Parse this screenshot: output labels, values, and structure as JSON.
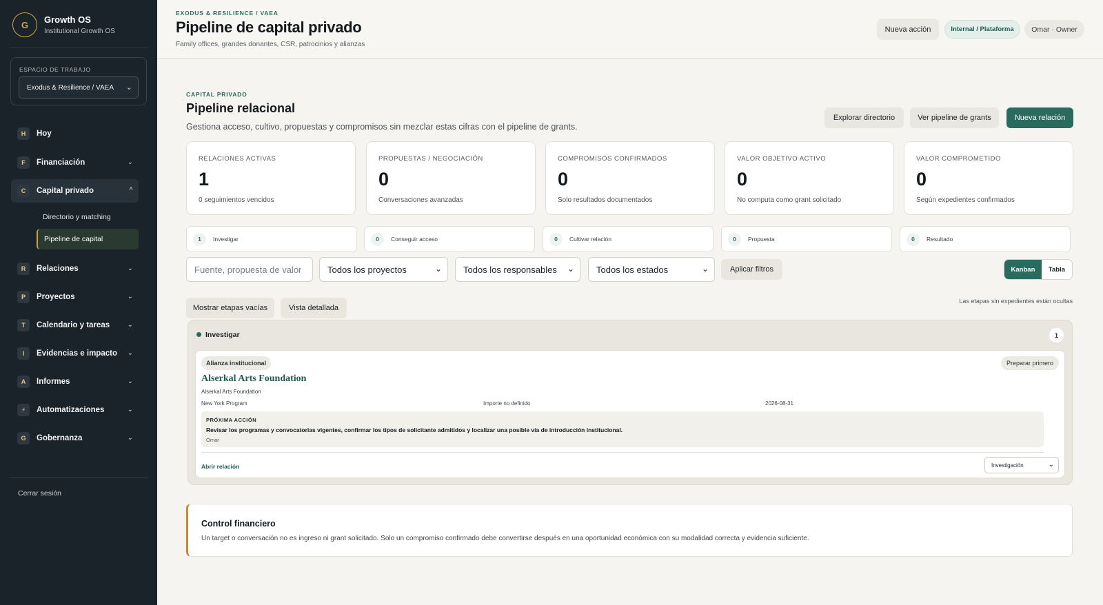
{
  "brand": {
    "logo_letter": "G",
    "name": "Growth OS",
    "subtitle": "Institutional Growth OS"
  },
  "workspace": {
    "label": "ESPACIO DE TRABAJO",
    "value": "Exodus & Resilience / VAEA"
  },
  "nav": {
    "hoy": {
      "badge": "H",
      "label": "Hoy"
    },
    "financiacion": {
      "badge": "F",
      "label": "Financiación"
    },
    "capital": {
      "badge": "C",
      "label": "Capital privado"
    },
    "capital_sub": [
      "Directorio y matching",
      "Pipeline de capital"
    ],
    "relaciones": {
      "badge": "R",
      "label": "Relaciones"
    },
    "proyectos": {
      "badge": "P",
      "label": "Proyectos"
    },
    "calendario": {
      "badge": "T",
      "label": "Calendario y tareas"
    },
    "evidencias": {
      "badge": "I",
      "label": "Evidencias e impacto"
    },
    "informes": {
      "badge": "A",
      "label": "Informes"
    },
    "automatizaciones": {
      "badge": "⚡",
      "label": "Automatizaciones"
    },
    "gobernanza": {
      "badge": "G",
      "label": "Gobernanza"
    }
  },
  "logout": "Cerrar sesión",
  "header": {
    "eyebrow": "EXODUS & RESILIENCE / VAEA",
    "title": "Pipeline de capital privado",
    "subtitle": "Family offices, grandes donantes, CSR, patrocinios y alianzas",
    "new_action": "Nueva acción",
    "scope_pill": "Internal / Plataforma",
    "user_pill": "Omar · Owner"
  },
  "section": {
    "eyebrow": "CAPITAL PRIVADO",
    "title": "Pipeline relacional",
    "description": "Gestiona acceso, cultivo, propuestas y compromisos sin mezclar estas cifras con el pipeline de grants.",
    "btn_directory": "Explorar directorio",
    "btn_grants": "Ver pipeline de grants",
    "btn_new": "Nueva relación"
  },
  "kpis": [
    {
      "label": "RELACIONES ACTIVAS",
      "value": "1",
      "note": "0 seguimientos vencidos"
    },
    {
      "label": "PROPUESTAS / NEGOCIACIÓN",
      "value": "0",
      "note": "Conversaciones avanzadas"
    },
    {
      "label": "COMPROMISOS CONFIRMADOS",
      "value": "0",
      "note": "Solo resultados documentados"
    },
    {
      "label": "VALOR OBJETIVO ACTIVO",
      "value": "0",
      "note": "No computa como grant solicitado"
    },
    {
      "label": "VALOR COMPROMETIDO",
      "value": "0",
      "note": "Según expedientes confirmados"
    }
  ],
  "stages": [
    {
      "count": "1",
      "name": "Investigar"
    },
    {
      "count": "0",
      "name": "Conseguir acceso"
    },
    {
      "count": "0",
      "name": "Cultivar relación"
    },
    {
      "count": "0",
      "name": "Propuesta"
    },
    {
      "count": "0",
      "name": "Resultado"
    }
  ],
  "filters": {
    "search_placeholder": "Fuente, propuesta de valor",
    "projects": "Todos los proyectos",
    "owners": "Todos los responsables",
    "states": "Todos los estados",
    "apply": "Aplicar filtros",
    "show_empty": "Mostrar etapas vacías",
    "detailed_view": "Vista detallada",
    "hidden_hint": "Las etapas sin expedientes están ocultas"
  },
  "view_toggle": {
    "kanban": "Kanban",
    "table": "Tabla"
  },
  "column": {
    "name": "Investigar",
    "count": "1",
    "card": {
      "tag": "Alianza institucional",
      "prepare": "Preparar primero",
      "title": "Alserkal Arts Foundation",
      "org": "Alserkal Arts Foundation",
      "program": "New York Program",
      "amount": "Importe no definido",
      "date": "2026-08-31",
      "next_label": "PRÓXIMA ACCIÓN",
      "next_text": "Revisar los programas y convocatorias vigentes, confirmar los tipos de solicitante admitidos y localizar una posible vía de introducción institucional.",
      "next_owner": "Omar",
      "open": "Abrir relación",
      "stage_select": "Investigación"
    }
  },
  "control": {
    "title": "Control financiero",
    "text": "Un target o conversación no es ingreso ni grant solicitado. Solo un compromiso confirmado debe convertirse después en una oportunidad económica con su modalidad correcta y evidencia suficiente."
  },
  "colors": {
    "sidebar": "#1b232a",
    "accent": "#2a6b5f",
    "gold": "#c08a3e",
    "background": "#f5f4f0"
  }
}
